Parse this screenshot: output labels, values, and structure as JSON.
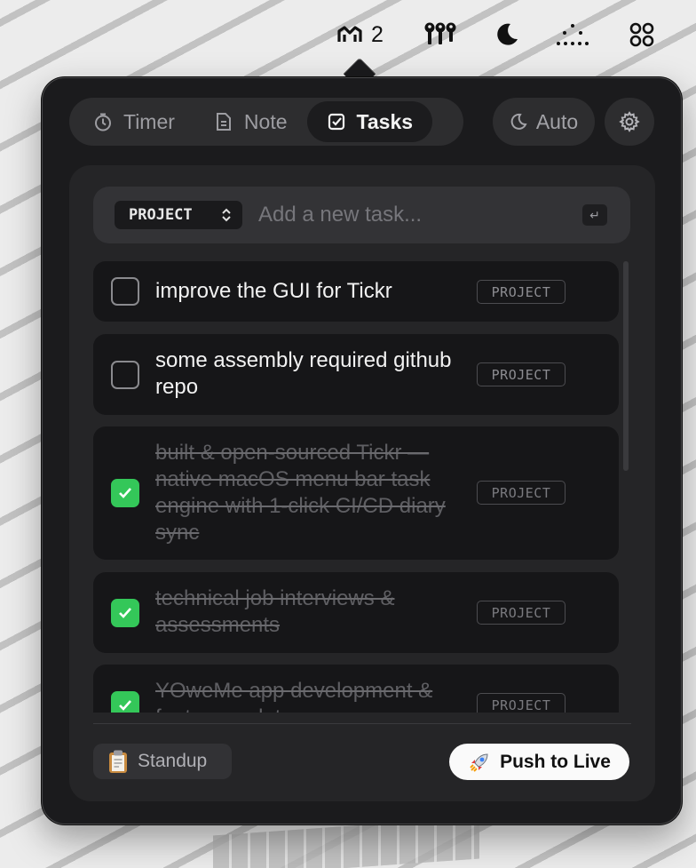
{
  "menubar": {
    "app_badge": "2",
    "icons": [
      "tickr-logo-icon",
      "keys-icon",
      "moon-icon",
      "dots-icon",
      "grid-icon"
    ]
  },
  "tabs": [
    {
      "label": "Timer",
      "icon": "stopwatch-icon",
      "active": false
    },
    {
      "label": "Note",
      "icon": "note-icon",
      "active": false
    },
    {
      "label": "Tasks",
      "icon": "task-check-icon",
      "active": true
    }
  ],
  "theme": {
    "label": "Auto",
    "icon": "moon-icon"
  },
  "settings": {
    "icon": "gear-icon"
  },
  "add_task": {
    "project_label": "PROJECT",
    "placeholder": "Add a new task...",
    "enter_symbol": "↵"
  },
  "tasks": [
    {
      "text": "improve the GUI for Tickr",
      "tag": "PROJECT",
      "done": false
    },
    {
      "text": "some assembly required github repo",
      "tag": "PROJECT",
      "done": false
    },
    {
      "text": "built & open-sourced Tickr — native macOS menu bar task engine with 1-click CI/CD diary sync",
      "tag": "PROJECT",
      "done": true
    },
    {
      "text": "technical job interviews & assessments",
      "tag": "PROJECT",
      "done": true
    },
    {
      "text": "YOweMe app development & feature updates",
      "tag": "PROJECT",
      "done": true
    }
  ],
  "footer": {
    "standup_label": "Standup",
    "standup_icon": "clipboard-icon",
    "push_label": "Push to Live",
    "push_icon": "rocket-icon"
  },
  "colors": {
    "accent_check": "#34c759",
    "popover_bg": "#1b1b1d",
    "panel_bg": "#252527"
  }
}
